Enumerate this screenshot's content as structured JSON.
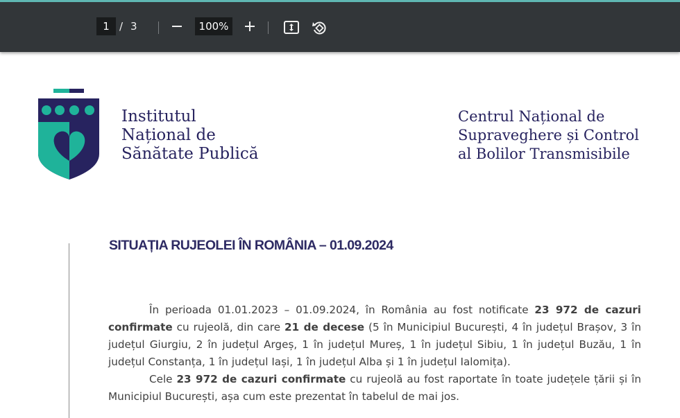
{
  "viewer": {
    "current_page": "1",
    "page_separator": "/",
    "total_pages": "3",
    "zoom_level": "100%",
    "icons": [
      "minus-icon",
      "plus-icon",
      "fit-page-icon",
      "rotate-icon"
    ]
  },
  "header": {
    "institute_name": "Institutul\nNațional de\nSănătate Publică",
    "center_name": "Centrul Național de\nSupraveghere și Control\nal Bolilor Transmisibile"
  },
  "colors": {
    "brand_navy": "#27235f",
    "brand_teal": "#1fb39a",
    "toolbar_bg": "#323639"
  },
  "document": {
    "title": "SITUAȚIA RUJEOLEI ÎN ROMÂNIA – 01.09.2024",
    "p1_a": "În perioada 01.01.2023 – 01.09.2024, în România au fost notificate ",
    "p1_b": "23 972 de cazuri confirmate",
    "p1_c": " cu rujeolă, din care ",
    "p1_d": "21 de decese",
    "p1_e": " (5 în Municipiul București, 4 în județul Brașov, 3 în județul Giurgiu, 2 în județul Argeș, 1 în județul Mureș, 1 în județul Sibiu, 1 în județul Buzău, 1 în județul Constanța, 1 în județul Iași, 1 în județul Alba și 1 în județul Ialomița).",
    "p2_a": "Cele ",
    "p2_b": "23 972 de cazuri confirmate",
    "p2_c": " cu rujeolă au fost raportate în toate județele țării și în Municipiul București, așa cum este prezentat în tabelul de mai jos."
  }
}
